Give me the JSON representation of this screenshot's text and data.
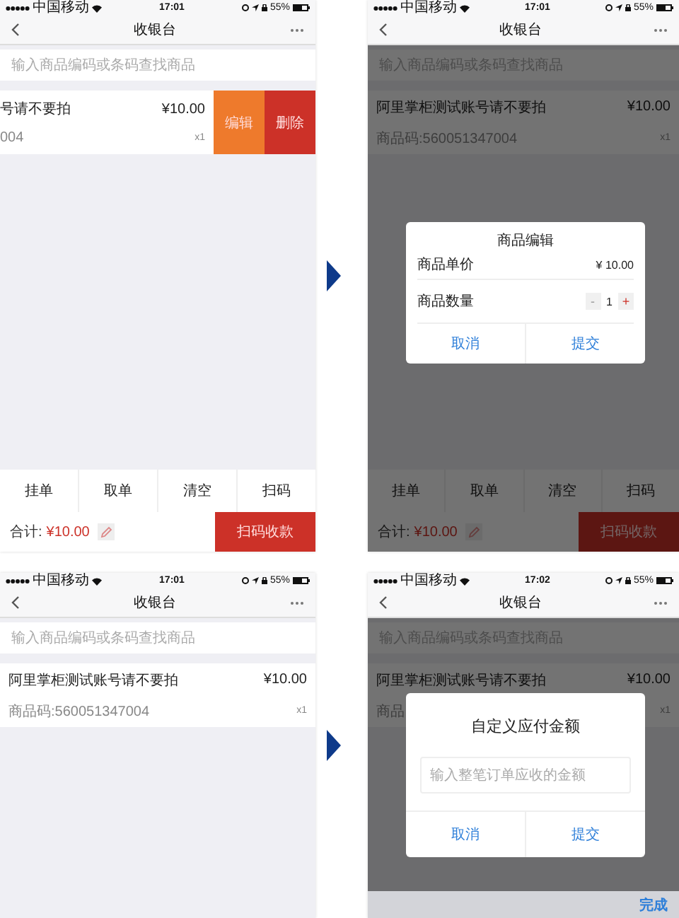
{
  "screens": [
    {
      "status_bar": {
        "carrier": "中国移动",
        "time": "17:01",
        "battery": "55%"
      },
      "nav": {
        "title": "收银台"
      },
      "search": {
        "placeholder": "输入商品编码或条码查找商品"
      },
      "item": {
        "name": "号请不要拍",
        "price": "¥10.00",
        "code": "004",
        "qty": "x1",
        "swiped": true,
        "actions": [
          {
            "label": "编辑",
            "kind": "edit"
          },
          {
            "label": "删除",
            "kind": "delete"
          }
        ]
      },
      "dimmed": false,
      "bottom_bar": {
        "buttons": [
          "挂单",
          "取单",
          "清空",
          "扫码"
        ],
        "total_label": "合计:",
        "total": "¥10.00",
        "pay_button": "扫码收款"
      }
    },
    {
      "status_bar": {
        "carrier": "中国移动",
        "time": "17:01",
        "battery": "55%"
      },
      "nav": {
        "title": "收银台"
      },
      "search": {
        "placeholder": "输入商品编码或条码查找商品"
      },
      "item": {
        "name": "阿里掌柜测试账号请不要拍",
        "price": "¥10.00",
        "code": "商品码:560051347004",
        "qty": "x1",
        "swiped": false
      },
      "dimmed": true,
      "dialog": {
        "kind": "edit",
        "title": "商品编辑",
        "rows": [
          {
            "kind": "value",
            "label": "商品单价",
            "value": "¥ 10.00"
          },
          {
            "kind": "stepper",
            "label": "商品数量",
            "minus": "-",
            "value": "1",
            "plus": "+"
          }
        ],
        "buttons": [
          "取消",
          "提交"
        ]
      },
      "bottom_bar": {
        "buttons": [
          "挂单",
          "取单",
          "清空",
          "扫码"
        ],
        "total_label": "合计:",
        "total": "¥10.00",
        "pay_button": "扫码收款"
      }
    },
    {
      "status_bar": {
        "carrier": "中国移动",
        "time": "17:01",
        "battery": "55%"
      },
      "nav": {
        "title": "收银台"
      },
      "search": {
        "placeholder": "输入商品编码或条码查找商品"
      },
      "item": {
        "name": "阿里掌柜测试账号请不要拍",
        "price": "¥10.00",
        "code": "商品码:560051347004",
        "qty": "x1",
        "swiped": false
      },
      "dimmed": false
    },
    {
      "status_bar": {
        "carrier": "中国移动",
        "time": "17:02",
        "battery": "55%"
      },
      "nav": {
        "title": "收银台"
      },
      "search": {
        "placeholder": "输入商品编码或条码查找商品"
      },
      "item": {
        "name": "阿里掌柜测试账号请不要拍",
        "price": "¥10.00",
        "code": "商品",
        "qty": "x1",
        "swiped": false
      },
      "dimmed": true,
      "dialog": {
        "kind": "input",
        "title": "自定义应付金额",
        "placeholder": "输入整笔订单应收的金额",
        "buttons": [
          "取消",
          "提交"
        ]
      },
      "keyboard_bar": {
        "done": "完成"
      }
    }
  ]
}
